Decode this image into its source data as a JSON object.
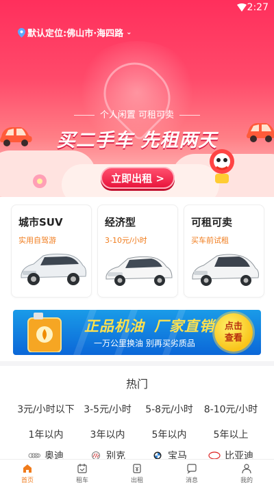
{
  "status_bar": {
    "time": "2:27"
  },
  "location": {
    "label": "默认定位:佛山市·海四路"
  },
  "hero": {
    "tagline": "个人闲置 可租可卖",
    "headline": "买二手车 先租两天",
    "cta_label": "立即出租 >"
  },
  "categories": [
    {
      "title": "城市SUV",
      "subtitle": "实用自驾游"
    },
    {
      "title": "经济型",
      "subtitle": "3-10元/小时"
    },
    {
      "title": "可租可卖",
      "subtitle": "买车前试租"
    }
  ],
  "banner": {
    "headline_part1": "正品机油",
    "headline_part2": "厂家直销",
    "subline": "一万公里换油 别再买劣质品",
    "cta_line1": "点击",
    "cta_line2": "查看"
  },
  "hot": {
    "title": "热门",
    "price_filters": [
      "3元/小时以下",
      "3-5元/小时",
      "5-8元/小时",
      "8-10元/小时"
    ],
    "age_filters": [
      "1年以内",
      "3年以内",
      "5年以内",
      "5年以上"
    ],
    "brands": [
      "奥迪",
      "别克",
      "宝马",
      "比亚迪"
    ]
  },
  "tabbar": {
    "items": [
      {
        "label": "首页",
        "icon": "home-icon",
        "active": true
      },
      {
        "label": "租车",
        "icon": "calendar-icon",
        "active": false
      },
      {
        "label": "出租",
        "icon": "document-icon",
        "active": false
      },
      {
        "label": "消息",
        "icon": "chat-bubble-icon",
        "active": false
      },
      {
        "label": "我的",
        "icon": "user-icon",
        "active": false
      }
    ],
    "active_color": "#f07b1b"
  },
  "colors": {
    "brand_red": "#ff2f5c",
    "accent_orange": "#f07b1b",
    "banner_blue": "#0b67d8"
  }
}
